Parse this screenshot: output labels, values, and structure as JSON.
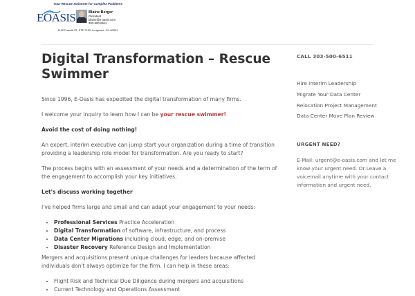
{
  "header": {
    "tagline": "Your Rescue Swimmer for Complex Problems",
    "logo_text": "EOASIS",
    "contact_name": "Blaine Berger",
    "contact_role": "President",
    "contact_email": "blaine@e-oasis.com",
    "contact_phone": "303-500-6511",
    "address": "1120 Francis ST, STE 7130, Longmont, CO 80501"
  },
  "main": {
    "title": "Digital Transformation – Rescue Swimmer",
    "p1": "Since 1996, E-Oasis has expedited the digital transformation of many firms.",
    "p2_prefix": "I welcome your inquiry to learn how I can be ",
    "p2_link": "your rescue swimmer!",
    "h_avoid": "Avoid the cost of doing nothing!",
    "p3": "An expert, interim executive can jump start your organization during a time of transition providing a leadership role model for transformation. Are you ready to start?",
    "p4": "The process begins with an assessment of your needs and a determination of the term of the engagement to accomplish your key initiatives.",
    "h_discuss": "Let's discuss working together",
    "p5": "I've helped firms large and small and can adapt your engagement to your needs:",
    "services": [
      {
        "name": "Professional Services",
        "desc": " Practice Acceleration"
      },
      {
        "name": "Digital Transformation",
        "desc": " of software, infrastructure, and process"
      },
      {
        "name": "Data Center Migrations",
        "desc": " including cloud, edge, and on-premise"
      },
      {
        "name": "Disaster Recovery",
        "desc": " Reference Design and Implementation"
      }
    ],
    "p6": "Mergers and acquisitions present unique challenges for leaders because affected individuals don't always optimize for the firm. I can help in these areas:",
    "ma_items": [
      "Flight Risk and Technical Due Diligence during mergers and acquisitions",
      "Current Technology and Operations Assessment"
    ]
  },
  "sidebar": {
    "call": "CALL 303-500-6511",
    "links": [
      "Hire Interim Leadership",
      "Migrate Your Data Center",
      "Relocation Project Management",
      "Data Center Move Plan Review"
    ],
    "urgent_heading": "URGENT NEED?",
    "urgent_text": "E-Mail: urgent@e-oasis.com and let me know your urgent need. Or Leave a voicemail anytime with your contact information and urgent need."
  },
  "colors": {
    "accent": "#b13d3d",
    "logo_blue": "#1a3a86",
    "heading": "#333333",
    "body_text": "#555555"
  }
}
